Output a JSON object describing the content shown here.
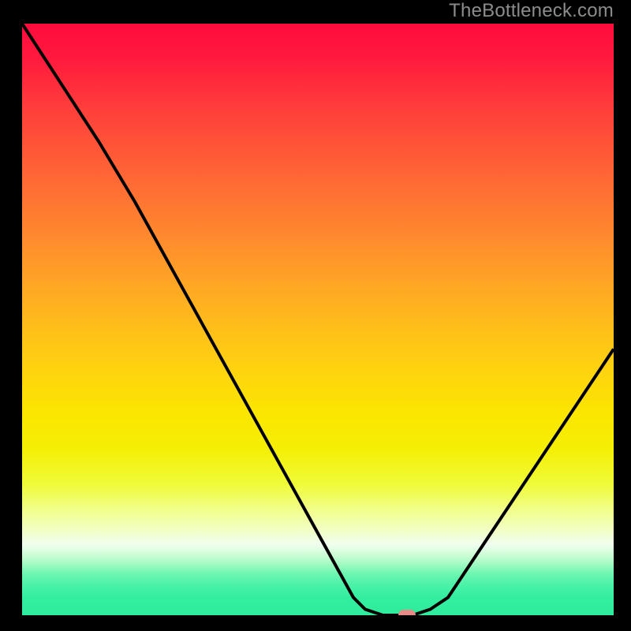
{
  "watermark": "TheBottleneck.com",
  "chart_data": {
    "type": "line",
    "title": "",
    "xlabel": "",
    "ylabel": "",
    "x_range": [
      0,
      100
    ],
    "y_range": [
      0,
      100
    ],
    "curve": [
      {
        "x": 0,
        "y": 100
      },
      {
        "x": 13,
        "y": 80
      },
      {
        "x": 19,
        "y": 70
      },
      {
        "x": 56,
        "y": 3
      },
      {
        "x": 58,
        "y": 1
      },
      {
        "x": 61,
        "y": 0
      },
      {
        "x": 66,
        "y": 0
      },
      {
        "x": 69,
        "y": 1
      },
      {
        "x": 72,
        "y": 3
      },
      {
        "x": 100,
        "y": 45
      }
    ],
    "marker": {
      "x": 65,
      "y": 0,
      "color": "#e88a86"
    },
    "background_gradient": {
      "top": "#ff0b3d",
      "mid": "#ffd210",
      "bottom": "#2eec9d"
    }
  }
}
